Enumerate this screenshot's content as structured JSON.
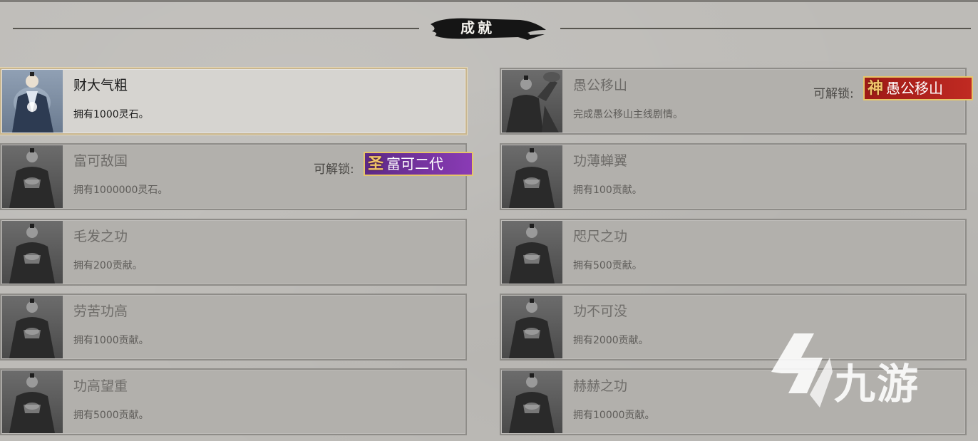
{
  "header": {
    "title": "成就"
  },
  "unlock_prefix": "可解锁:",
  "left_column": [
    {
      "name": "财大气粗",
      "desc": "拥有1000灵石。",
      "unlocked": true,
      "portrait": "cultivator-portrait-lit-icon"
    },
    {
      "name": "富可敌国",
      "desc": "拥有1000000灵石。",
      "unlocked": false,
      "portrait": "cultivator-portrait-dim-icon",
      "reward": {
        "glyph": "圣",
        "text": "富可二代",
        "color": "#7a34a8"
      }
    },
    {
      "name": "毛发之功",
      "desc": "拥有200贡献。",
      "unlocked": false,
      "portrait": "cultivator-portrait-dim-icon"
    },
    {
      "name": "劳苦功高",
      "desc": "拥有1000贡献。",
      "unlocked": false,
      "portrait": "cultivator-portrait-dim-icon"
    },
    {
      "name": "功高望重",
      "desc": "拥有5000贡献。",
      "unlocked": false,
      "portrait": "cultivator-portrait-dim-icon"
    }
  ],
  "right_column": [
    {
      "name": "愚公移山",
      "desc": "完成愚公移山主线剧情。",
      "unlocked": false,
      "portrait": "yugong-portrait-icon",
      "reward": {
        "glyph": "神",
        "text": "愚公移山",
        "color": "#b3231d"
      }
    },
    {
      "name": "功薄蝉翼",
      "desc": "拥有100贡献。",
      "unlocked": false,
      "portrait": "cultivator-portrait-dim-icon"
    },
    {
      "name": "咫尺之功",
      "desc": "拥有500贡献。",
      "unlocked": false,
      "portrait": "cultivator-portrait-dim-icon"
    },
    {
      "name": "功不可没",
      "desc": "拥有2000贡献。",
      "unlocked": false,
      "portrait": "cultivator-portrait-dim-icon"
    },
    {
      "name": "赫赫之功",
      "desc": "拥有10000贡献。",
      "unlocked": false,
      "portrait": "cultivator-portrait-dim-icon"
    }
  ],
  "watermark": {
    "text": "九游",
    "icon": "jiuyou-logo-icon"
  }
}
